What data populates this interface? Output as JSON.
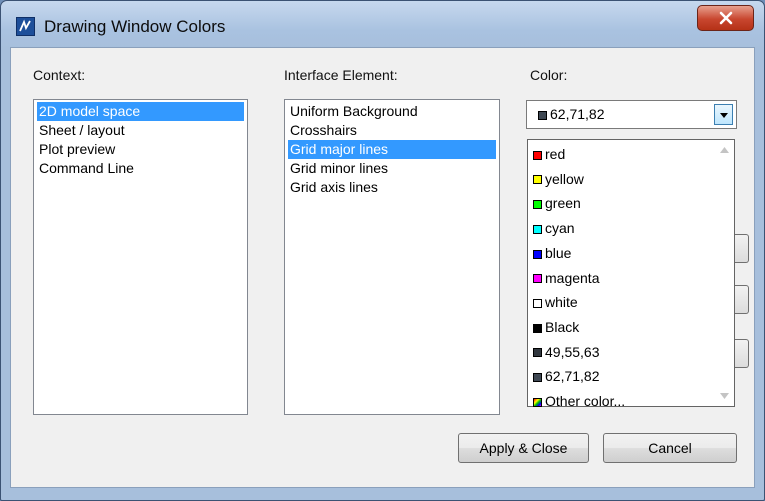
{
  "window": {
    "title": "Drawing Window Colors",
    "close_label": "x"
  },
  "context": {
    "label": "Context:",
    "items": [
      "2D model space",
      "Sheet / layout",
      "Plot preview",
      "Command Line"
    ],
    "selected": "2D model space"
  },
  "interface": {
    "label": "Interface Element:",
    "items": [
      "Uniform Background",
      "Crosshairs",
      "Grid major lines",
      "Grid minor lines",
      "Grid axis lines"
    ],
    "selected": "Grid major lines"
  },
  "color": {
    "label": "Color:",
    "current_value": "62,71,82",
    "current_swatch": "#3e4752",
    "options": [
      {
        "label": "red",
        "swatch": "#ff0000"
      },
      {
        "label": "yellow",
        "swatch": "#ffff00"
      },
      {
        "label": "green",
        "swatch": "#00ff00"
      },
      {
        "label": "cyan",
        "swatch": "#00ffff"
      },
      {
        "label": "blue",
        "swatch": "#0000ff"
      },
      {
        "label": "magenta",
        "swatch": "#ff00ff"
      },
      {
        "label": "white",
        "swatch": "#ffffff"
      },
      {
        "label": "Black",
        "swatch": "#000000"
      },
      {
        "label": "49,55,63",
        "swatch": "#31373f"
      },
      {
        "label": "62,71,82",
        "swatch": "#3e4752"
      },
      {
        "label": "Other color...",
        "swatch": "multicolor"
      }
    ]
  },
  "buttons": {
    "apply_close": "Apply & Close",
    "cancel": "Cancel"
  },
  "colors": {
    "selection": "#3399ff",
    "title_gradient_top": "#c6d8ee",
    "close_button": "#c8462f"
  }
}
